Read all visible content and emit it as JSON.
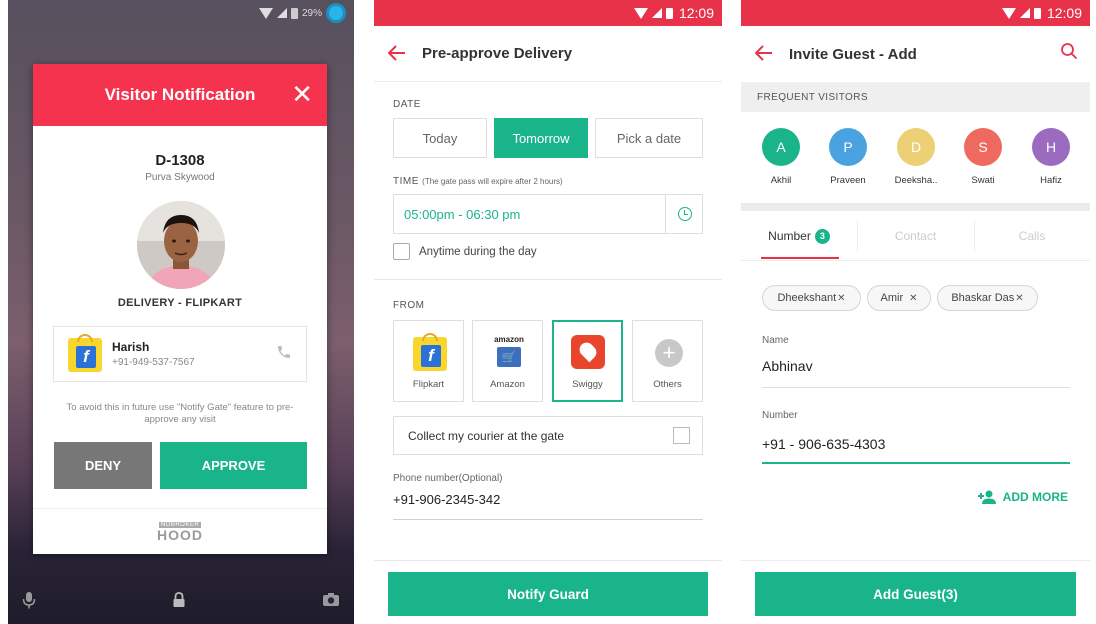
{
  "screen1": {
    "status": {
      "battery": "29%"
    },
    "modal": {
      "title": "Visitor Notification",
      "close": "✕",
      "flat_no": "D-1308",
      "flat_name": "Purva Skywood",
      "delivery_label": "DELIVERY - FLIPKART",
      "courier_name": "Harish",
      "courier_phone": "+91-949-537-7567",
      "hint": "To avoid this in future use \"Notify Gate\" feature to pre-approve any visit",
      "deny": "DENY",
      "approve": "APPROVE",
      "footer_small": "NOBROKER",
      "footer_big": "HOOD"
    }
  },
  "screen2": {
    "status": {
      "time": "12:09"
    },
    "title": "Pre-approve Delivery",
    "date_label": "DATE",
    "date_options": [
      "Today",
      "Tomorrow",
      "Pick a date"
    ],
    "date_selected": "Tomorrow",
    "time_label": "TIME",
    "time_note": "(The gate pass will expire after 2 hours)",
    "time_value": "05:00pm - 06:30 pm",
    "anytime_label": "Anytime during the day",
    "from_label": "FROM",
    "from_options": [
      "Flipkart",
      "Amazon",
      "Swiggy",
      "Others"
    ],
    "from_selected": "Swiggy",
    "amazon_word": "amazon",
    "collect_label": "Collect my courier at the gate",
    "phone_label": "Phone number(Optional)",
    "phone_value": "+91-906-2345-342",
    "cta": "Notify Guard"
  },
  "screen3": {
    "status": {
      "time": "12:09"
    },
    "title": "Invite Guest - Add",
    "frequent_label": "FREQUENT VISITORS",
    "visitors": [
      {
        "initial": "A",
        "name": "Akhil",
        "color": "#1ab48b"
      },
      {
        "initial": "P",
        "name": "Praveen",
        "color": "#4aa3e0"
      },
      {
        "initial": "D",
        "name": "Deeksha..",
        "color": "#edcf75"
      },
      {
        "initial": "S",
        "name": "Swati",
        "color": "#ee6a5e"
      },
      {
        "initial": "H",
        "name": "Hafiz",
        "color": "#9b6bbf"
      }
    ],
    "tabs": {
      "number": "Number",
      "number_count": "3",
      "contact": "Contact",
      "calls": "Calls"
    },
    "chips": [
      "Dheekshant",
      "Amir",
      "Bhaskar Das"
    ],
    "chip_close": "✕",
    "name_label": "Name",
    "name_value": "Abhinav",
    "number_label": "Number",
    "number_value": "+91 - 906-635-4303",
    "add_more": "ADD MORE",
    "cta": "Add Guest(3)"
  },
  "colors": {
    "brand_red": "#e8324a",
    "brand_green": "#1ab48b"
  }
}
